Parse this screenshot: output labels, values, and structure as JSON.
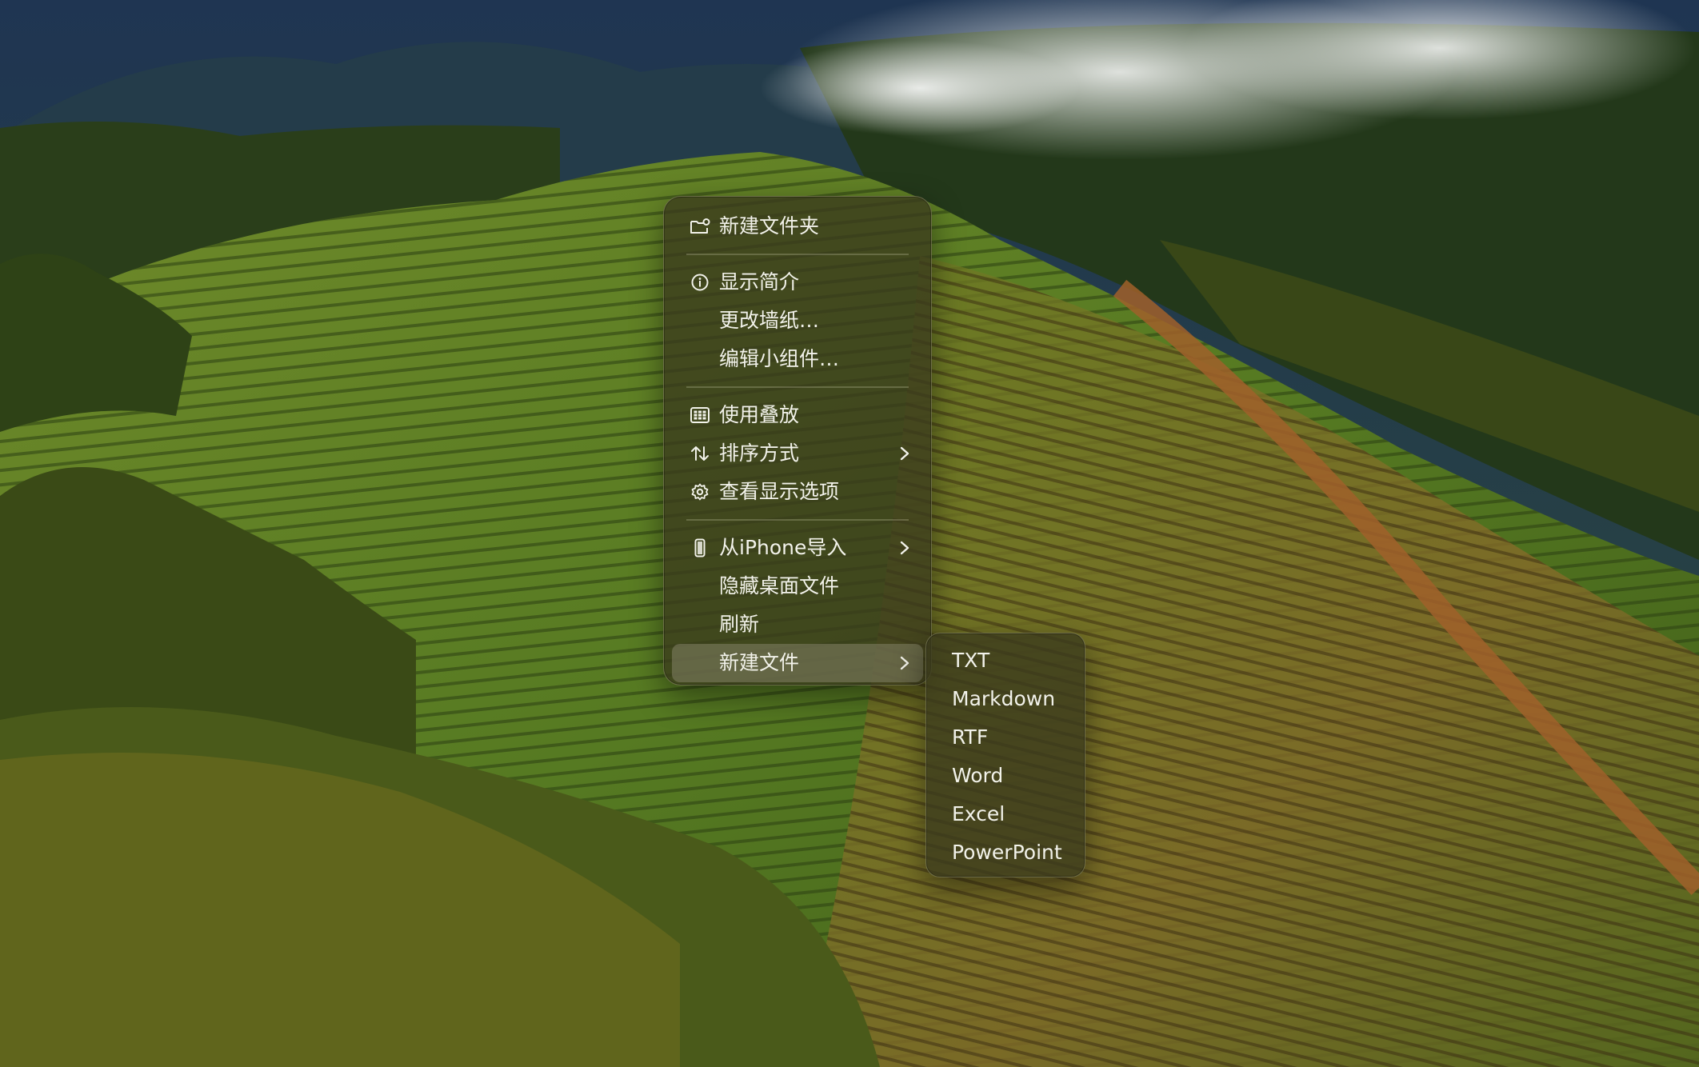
{
  "context_menu": {
    "items": [
      {
        "label": "新建文件夹",
        "icon": "folder-badge-icon"
      },
      {
        "label": "显示简介",
        "icon": "info-icon"
      },
      {
        "label": "更改墙纸…"
      },
      {
        "label": "编辑小组件…"
      },
      {
        "label": "使用叠放",
        "icon": "stacks-grid-icon"
      },
      {
        "label": "排序方式",
        "icon": "sort-arrows-icon",
        "submenu": true
      },
      {
        "label": "查看显示选项",
        "icon": "gear-icon"
      },
      {
        "label": "从iPhone导入",
        "icon": "iphone-icon",
        "submenu": true
      },
      {
        "label": "隐藏桌面文件"
      },
      {
        "label": "刷新"
      },
      {
        "label": "新建文件",
        "submenu": true,
        "highlighted": true
      }
    ]
  },
  "new_file_submenu": {
    "items": [
      "TXT",
      "Markdown",
      "RTF",
      "Word",
      "Excel",
      "PowerPoint"
    ]
  },
  "colors": {
    "menu_background": "#3a3a1c",
    "highlight": "#78785a",
    "text": "#f2f2ea"
  }
}
